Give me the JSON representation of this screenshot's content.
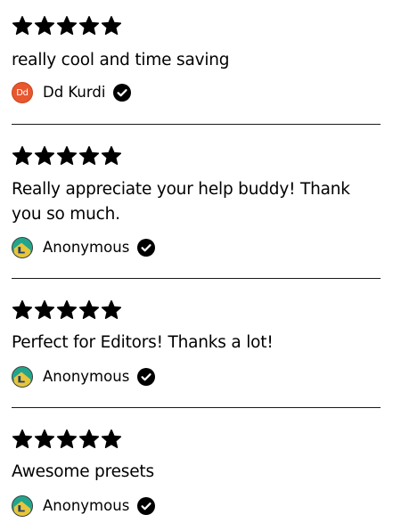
{
  "reviews": [
    {
      "rating": 5,
      "text": "really cool and time saving",
      "author": "Dd Kurdi",
      "avatar_type": "initials",
      "avatar_initials": "Dd",
      "avatar_color": "#e8572e",
      "verified": true
    },
    {
      "rating": 5,
      "text": "Really appreciate your help buddy! Thank you so much.",
      "author": "Anonymous",
      "avatar_type": "image",
      "verified": true
    },
    {
      "rating": 5,
      "text": "Perfect for Editors! Thanks a lot!",
      "author": "Anonymous",
      "avatar_type": "image",
      "verified": true
    },
    {
      "rating": 5,
      "text": "Awesome presets",
      "author": "Anonymous",
      "avatar_type": "image",
      "verified": true
    }
  ],
  "icons": {
    "star": "star-icon",
    "verified": "verified-check-icon"
  },
  "colors": {
    "star": "#000000",
    "text": "#000000",
    "separator": "#1a1a1a",
    "anon_avatar_bg": "#22a58c"
  }
}
